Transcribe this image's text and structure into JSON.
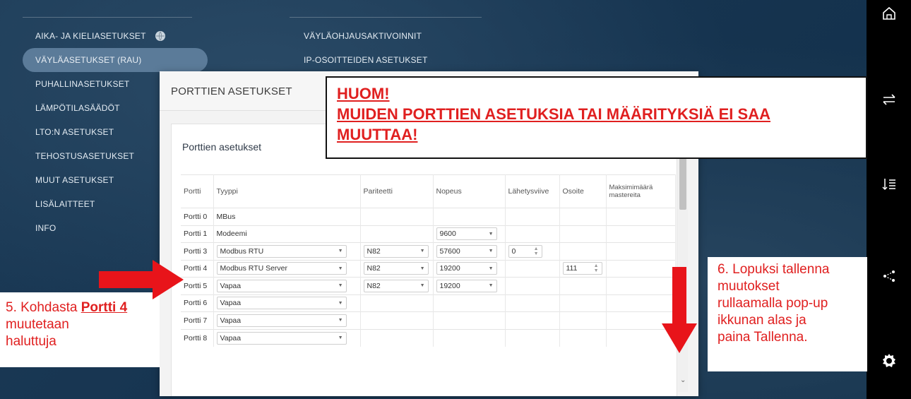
{
  "left_menu": {
    "items": [
      {
        "label": "AIKA- JA KIELIASETUKSET"
      },
      {
        "label": "VÄYLÄASETUKSET (RAU)"
      },
      {
        "label": "PUHALLINASETUKSET"
      },
      {
        "label": "LÄMPÖTILASÄÄDÖT"
      },
      {
        "label": "LTO:N ASETUKSET"
      },
      {
        "label": "TEHOSTUSASETUKSET"
      },
      {
        "label": "MUUT ASETUKSET"
      },
      {
        "label": "LISÄLAITTEET"
      },
      {
        "label": "INFO"
      }
    ]
  },
  "right_menu": {
    "items": [
      {
        "label": "VÄYLÄOHJAUSAKTIVOINNIT"
      },
      {
        "label": "IP-OSOITTEIDEN ASETUKSET"
      }
    ]
  },
  "sidebar": {
    "icons": [
      "home-icon",
      "swap-arrows-icon",
      "sort-list-icon",
      "share-nodes-icon",
      "settings-gear-icon"
    ]
  },
  "modal": {
    "title": "PORTTIEN ASETUKSET",
    "card_title": "Porttien asetukset",
    "table": {
      "headers": [
        "Portti",
        "Tyyppi",
        "Pariteetti",
        "Nopeus",
        "Lähetysviive",
        "Osoite",
        "Maksimimäärä mastereita"
      ],
      "rows": [
        {
          "port": "Portti 0",
          "type": "MBus",
          "type_select": false,
          "parity": "",
          "speed": "",
          "delay": "",
          "address": ""
        },
        {
          "port": "Portti 1",
          "type": "Modeemi",
          "type_select": false,
          "parity": "",
          "speed": "9600",
          "delay": "",
          "address": ""
        },
        {
          "port": "Portti 3",
          "type": "Modbus RTU",
          "type_select": true,
          "parity": "N82",
          "speed": "57600",
          "delay": "0",
          "address": ""
        },
        {
          "port": "Portti 4",
          "type": "Modbus RTU Server",
          "type_select": true,
          "parity": "N82",
          "speed": "19200",
          "delay": "",
          "address": "111"
        },
        {
          "port": "Portti 5",
          "type": "Vapaa",
          "type_select": true,
          "parity": "N82",
          "speed": "19200",
          "delay": "",
          "address": ""
        },
        {
          "port": "Portti 6",
          "type": "Vapaa",
          "type_select": true,
          "parity": "",
          "speed": "",
          "delay": "",
          "address": ""
        },
        {
          "port": "Portti 7",
          "type": "Vapaa",
          "type_select": true,
          "parity": "",
          "speed": "",
          "delay": "",
          "address": ""
        },
        {
          "port": "Portti 8",
          "type": "Vapaa",
          "type_select": true,
          "parity": "",
          "speed": "",
          "delay": "",
          "address": ""
        }
      ]
    }
  },
  "annotations": {
    "huom_line1": "HUOM!",
    "huom_line2": "MUIDEN PORTTIEN ASETUKSIA TAI MÄÄRITYKSIÄ EI SAA",
    "huom_line3": "MUUTTAA!",
    "left_note_prefix": "5. Kohdasta ",
    "left_note_strong": "Portti 4",
    "left_note_rest1": "muutetaan",
    "left_note_rest2": "haluttuja",
    "right_note_lines": [
      "6. Lopuksi tallenna",
      "muutokset",
      "rullaamalla pop-up",
      "ikkunan alas ja",
      "paina Tallenna."
    ]
  },
  "colors": {
    "annotation_red": "#e02020",
    "arrow_red": "#e8141a",
    "active_menu": "#5b7b99",
    "background": "#1a3a56"
  }
}
